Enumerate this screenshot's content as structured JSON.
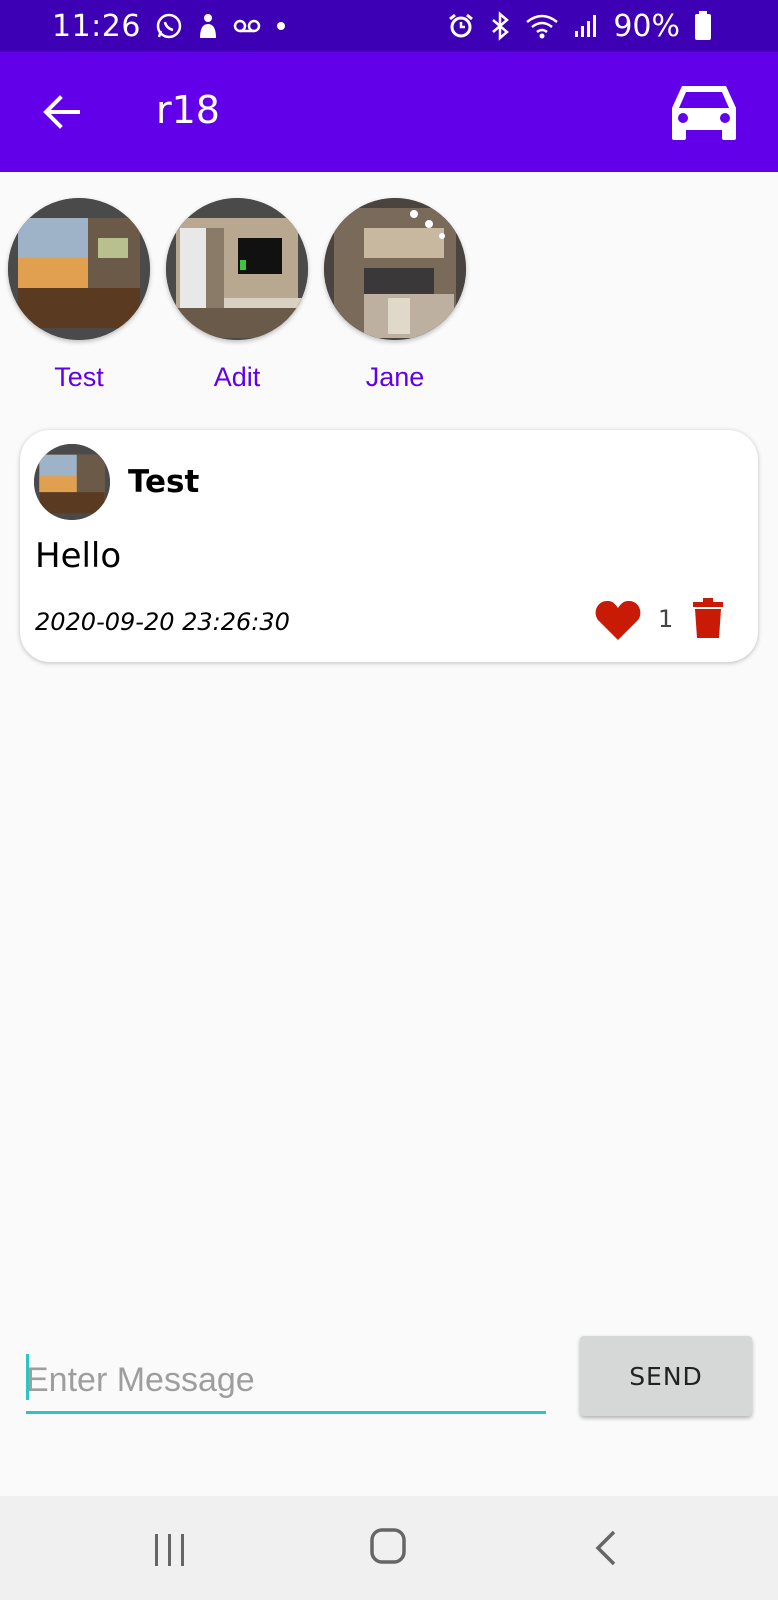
{
  "status_bar": {
    "time": "11:26",
    "battery": "90%",
    "icons_left": [
      "whatsapp-icon",
      "person-icon",
      "voicemail-icon",
      "dot-icon"
    ],
    "icons_right": [
      "alarm-icon",
      "bluetooth-icon",
      "wifi-icon",
      "signal-icon",
      "battery-icon"
    ]
  },
  "app_bar": {
    "title": "r18",
    "back_icon": "arrow-back-icon",
    "action_icon": "car-icon"
  },
  "members": [
    {
      "name": "Test"
    },
    {
      "name": "Adit"
    },
    {
      "name": "Jane"
    }
  ],
  "message": {
    "author": "Test",
    "text": "Hello",
    "timestamp": "2020-09-20 23:26:30",
    "likes": "1"
  },
  "composer": {
    "placeholder": "Enter Message",
    "send_label": "SEND"
  },
  "colors": {
    "status_bar": "#3d00b5",
    "app_bar": "#6200ea",
    "accent_teal": "#2cc5c0",
    "heart_red": "#c81a05"
  }
}
